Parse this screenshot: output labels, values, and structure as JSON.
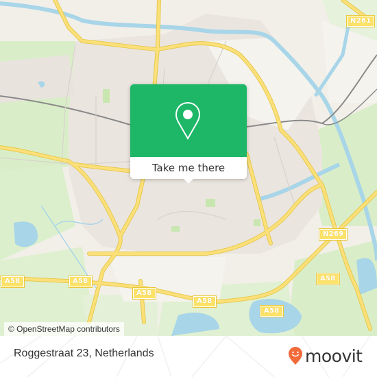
{
  "map": {
    "road_labels": [
      {
        "id": "n261",
        "text": "N261"
      },
      {
        "id": "n269",
        "text": "N269"
      },
      {
        "id": "a58-1",
        "text": "A58"
      },
      {
        "id": "a58-2",
        "text": "A58"
      },
      {
        "id": "a58-3",
        "text": "A58"
      },
      {
        "id": "a58-4",
        "text": "A58"
      },
      {
        "id": "a58-5",
        "text": "A58"
      },
      {
        "id": "a58-6",
        "text": "A58"
      }
    ],
    "attribution": "© OpenStreetMap contributors",
    "colors": {
      "land": "#f2efe9",
      "urban": "#e9e3de",
      "green": "#d6edc4",
      "water": "#a8d5e8",
      "road": "#fbe07a",
      "rail": "#7d7d7d"
    }
  },
  "popup": {
    "icon": "map-pin-icon",
    "button_label": "Take me there",
    "color": "#1db767"
  },
  "footer": {
    "address": "Roggestraat 23, Netherlands",
    "brand": "moovit",
    "brand_icon": "moovit-smile-pin-icon",
    "brand_color": "#f26b3a"
  }
}
